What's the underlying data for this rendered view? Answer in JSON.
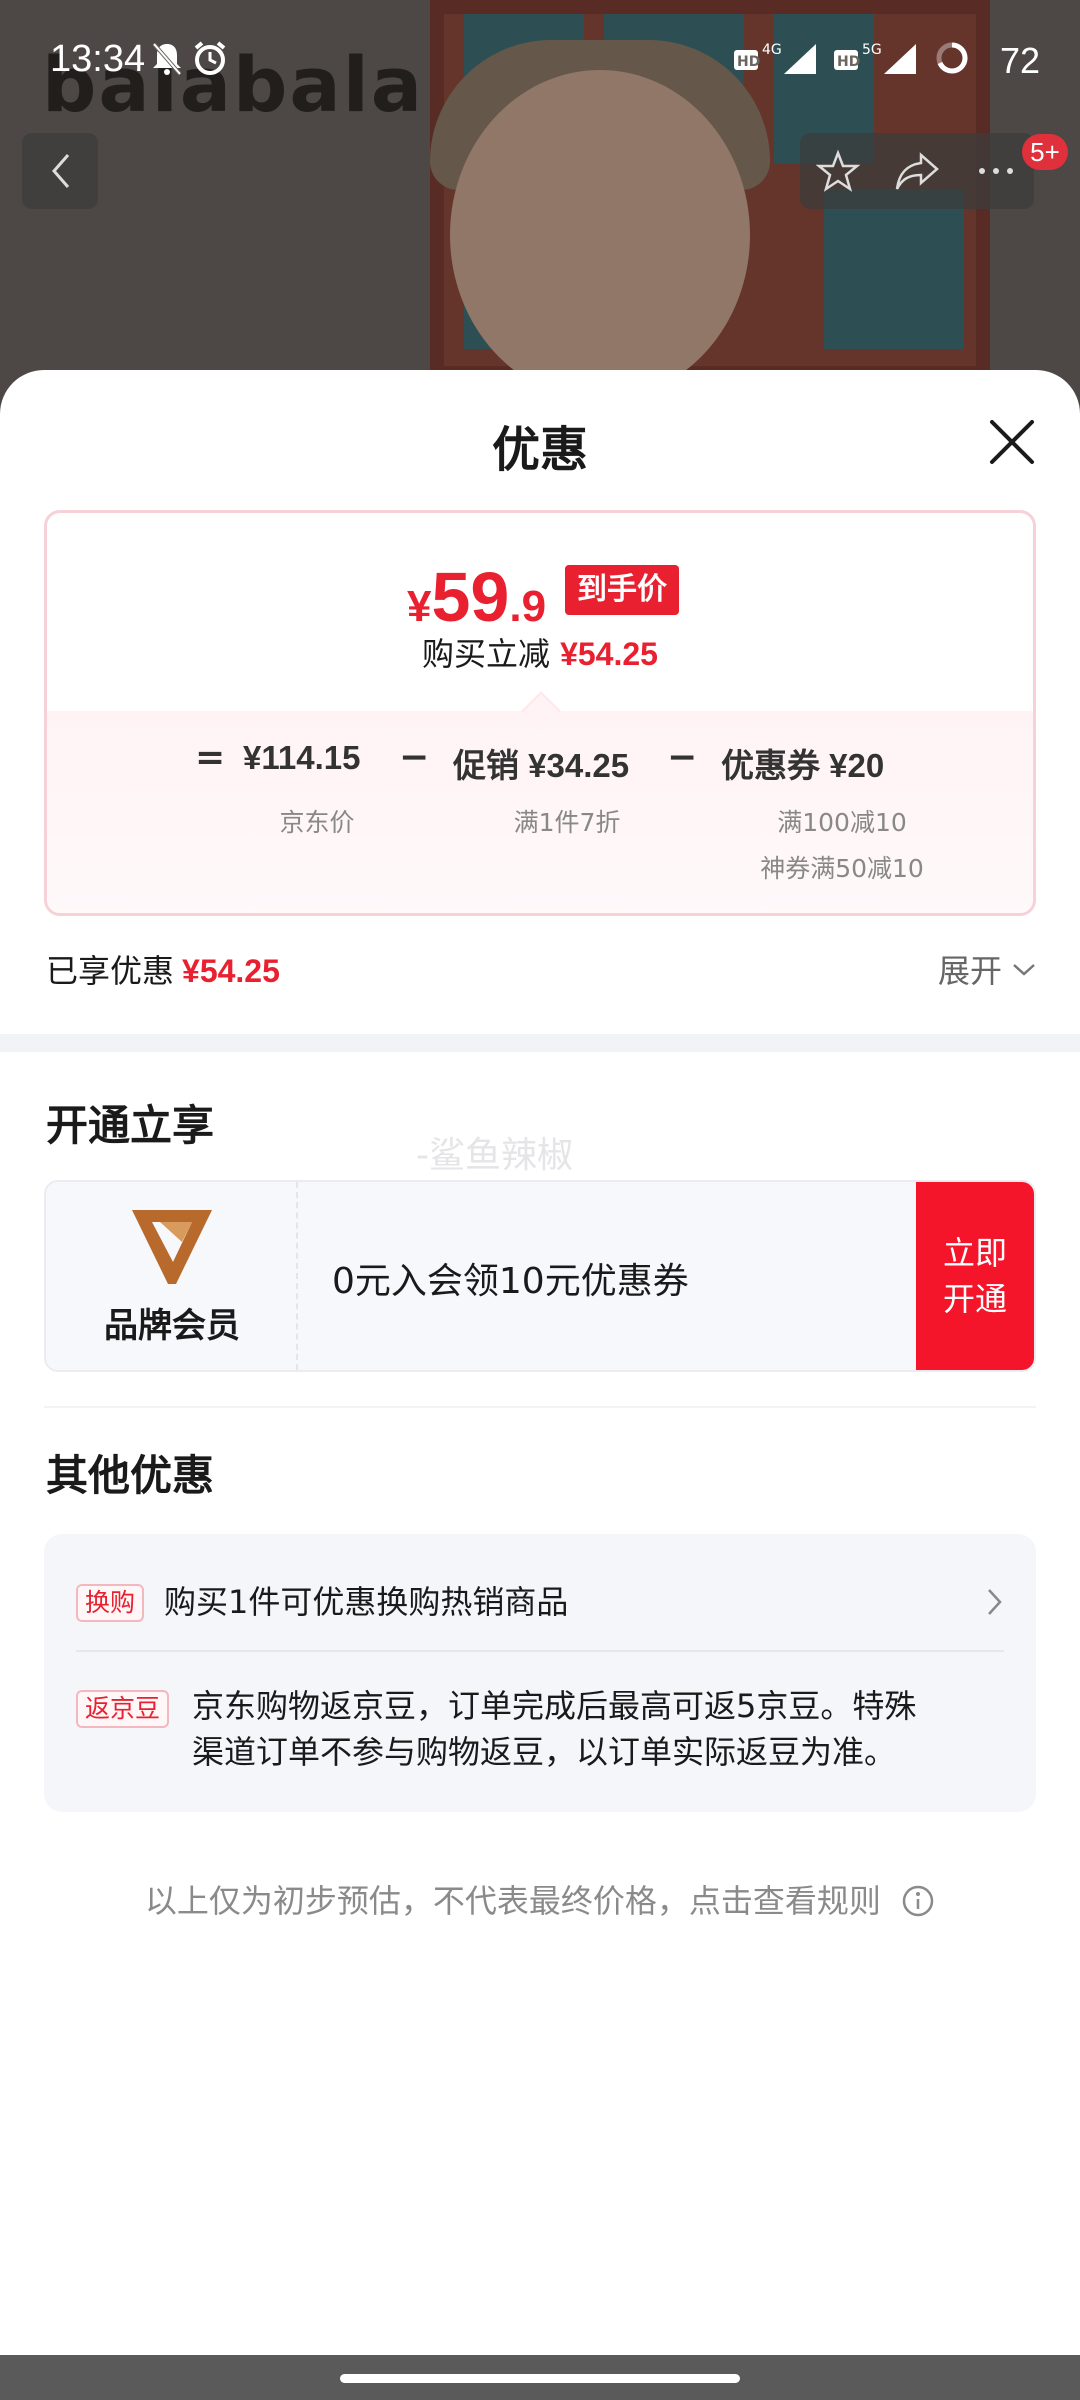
{
  "status_bar": {
    "time": "13:34",
    "network_1": "4G",
    "network_2": "5G",
    "battery": "72",
    "icons": [
      "mute-icon",
      "alarm-icon",
      "hd-icon",
      "signal-icon",
      "battery-ring-icon"
    ]
  },
  "background": {
    "brand_text": "balabala"
  },
  "nav": {
    "badge": "5+",
    "icons": [
      "back-icon",
      "star-icon",
      "share-icon",
      "more-icon"
    ]
  },
  "sheet": {
    "title": "优惠",
    "final_price": {
      "yen": "¥",
      "integer": "59",
      "decimal": ".9",
      "tag": "到手价"
    },
    "instant": {
      "label": "购买立减",
      "amount": "¥54.25"
    },
    "calc": {
      "equals": "=",
      "minus": "−",
      "jd_price": "¥114.15",
      "jd_price_label": "京东价",
      "promo": "促销 ¥34.25",
      "promo_label": "满1件7折",
      "coupon": "优惠券 ¥20",
      "coupon_label_1": "满100减10",
      "coupon_label_2": "神券满50减10"
    },
    "enjoyed": {
      "label": "已享优惠",
      "amount": "¥54.25"
    },
    "expand_label": "展开",
    "open_section": {
      "title": "开通立享",
      "watermark": "-鲨鱼辣椒",
      "member_name": "品牌会员",
      "member_desc": "0元入会领10元优惠券",
      "button_line_1": "立即",
      "button_line_2": "开通"
    },
    "other_section": {
      "title": "其他优惠",
      "items": [
        {
          "tag": "换购",
          "text": "购买1件可优惠换购热销商品"
        },
        {
          "tag": "返京豆",
          "text_line_1": "京东购物返京豆，订单完成后最高可返5京豆。特殊",
          "text_line_2": "渠道订单不参与购物返豆，以订单实际返豆为准。"
        }
      ]
    },
    "footnote": "以上仅为初步预估，不代表最终价格，点击查看规则"
  },
  "colors": {
    "accent_red": "#e8202f",
    "button_red": "#f5152b",
    "brand_gold": "#b86a2c"
  }
}
